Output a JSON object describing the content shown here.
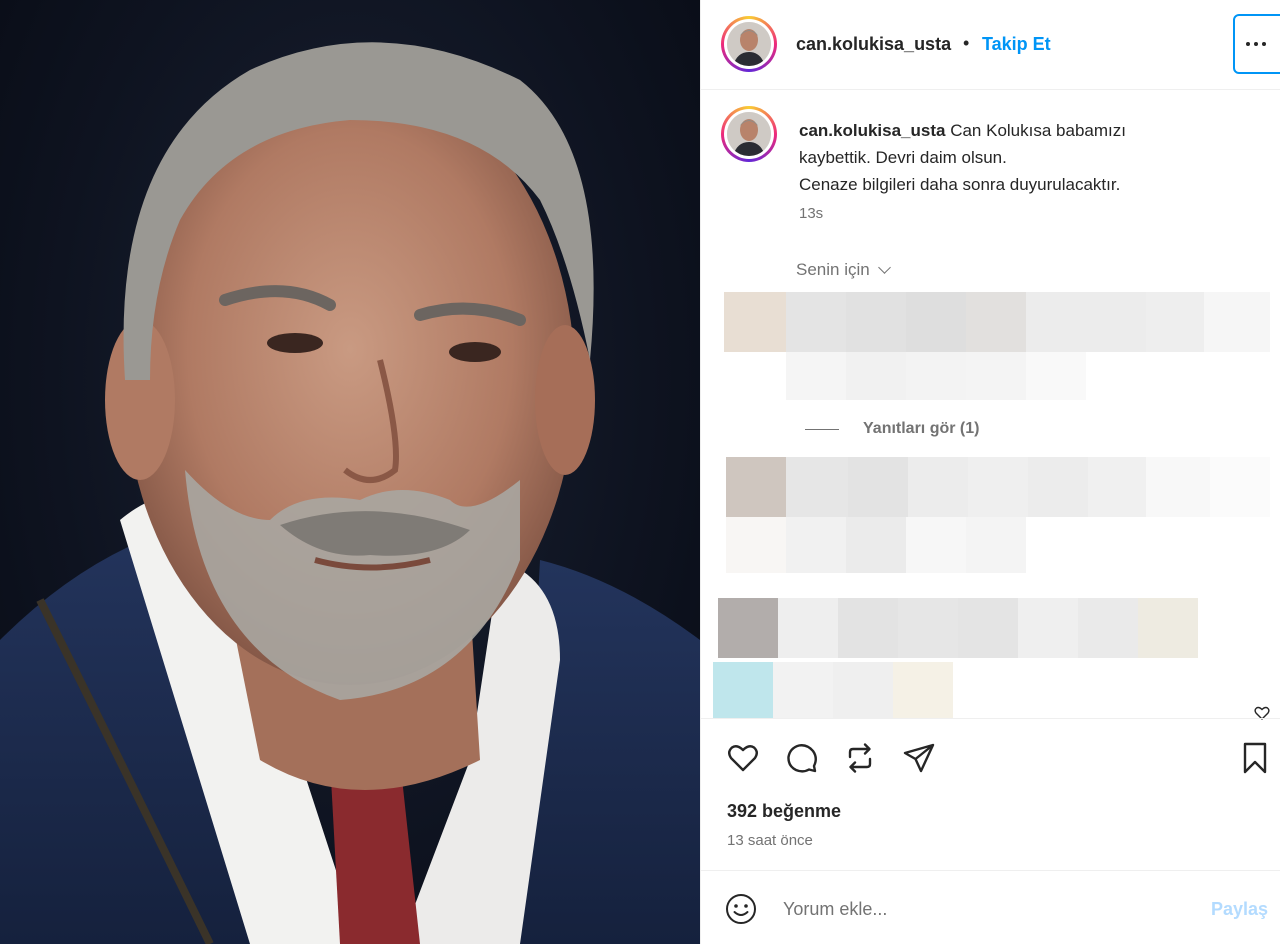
{
  "post": {
    "username": "can.kolukisa_usta",
    "separator": "•",
    "follow_label": "Takip Et",
    "more_label": "Diğer seçenekler"
  },
  "caption": {
    "username": "can.kolukisa_usta",
    "text_line1": "Can Kolukısa babamızı",
    "text_line2": "kaybettik. Devri daim olsun.",
    "text_line3": "Cenaze bilgileri daha sonra duyurulacaktır.",
    "time": "13s"
  },
  "comments": {
    "filter_label": "Senin için",
    "view_replies": "Yanıtları gör (1)"
  },
  "actions": {
    "likes": "392 beğenme",
    "time_ago": "13 saat önce",
    "icons": [
      "heart-icon",
      "comment-icon",
      "repost-icon",
      "share-icon",
      "bookmark-icon"
    ]
  },
  "comment_box": {
    "placeholder": "Yorum ekle...",
    "share_label": "Paylaş"
  },
  "colors": {
    "accent": "#0095f6",
    "share_disabled": "#b3dbff",
    "muted": "#737373",
    "text": "#262626"
  }
}
